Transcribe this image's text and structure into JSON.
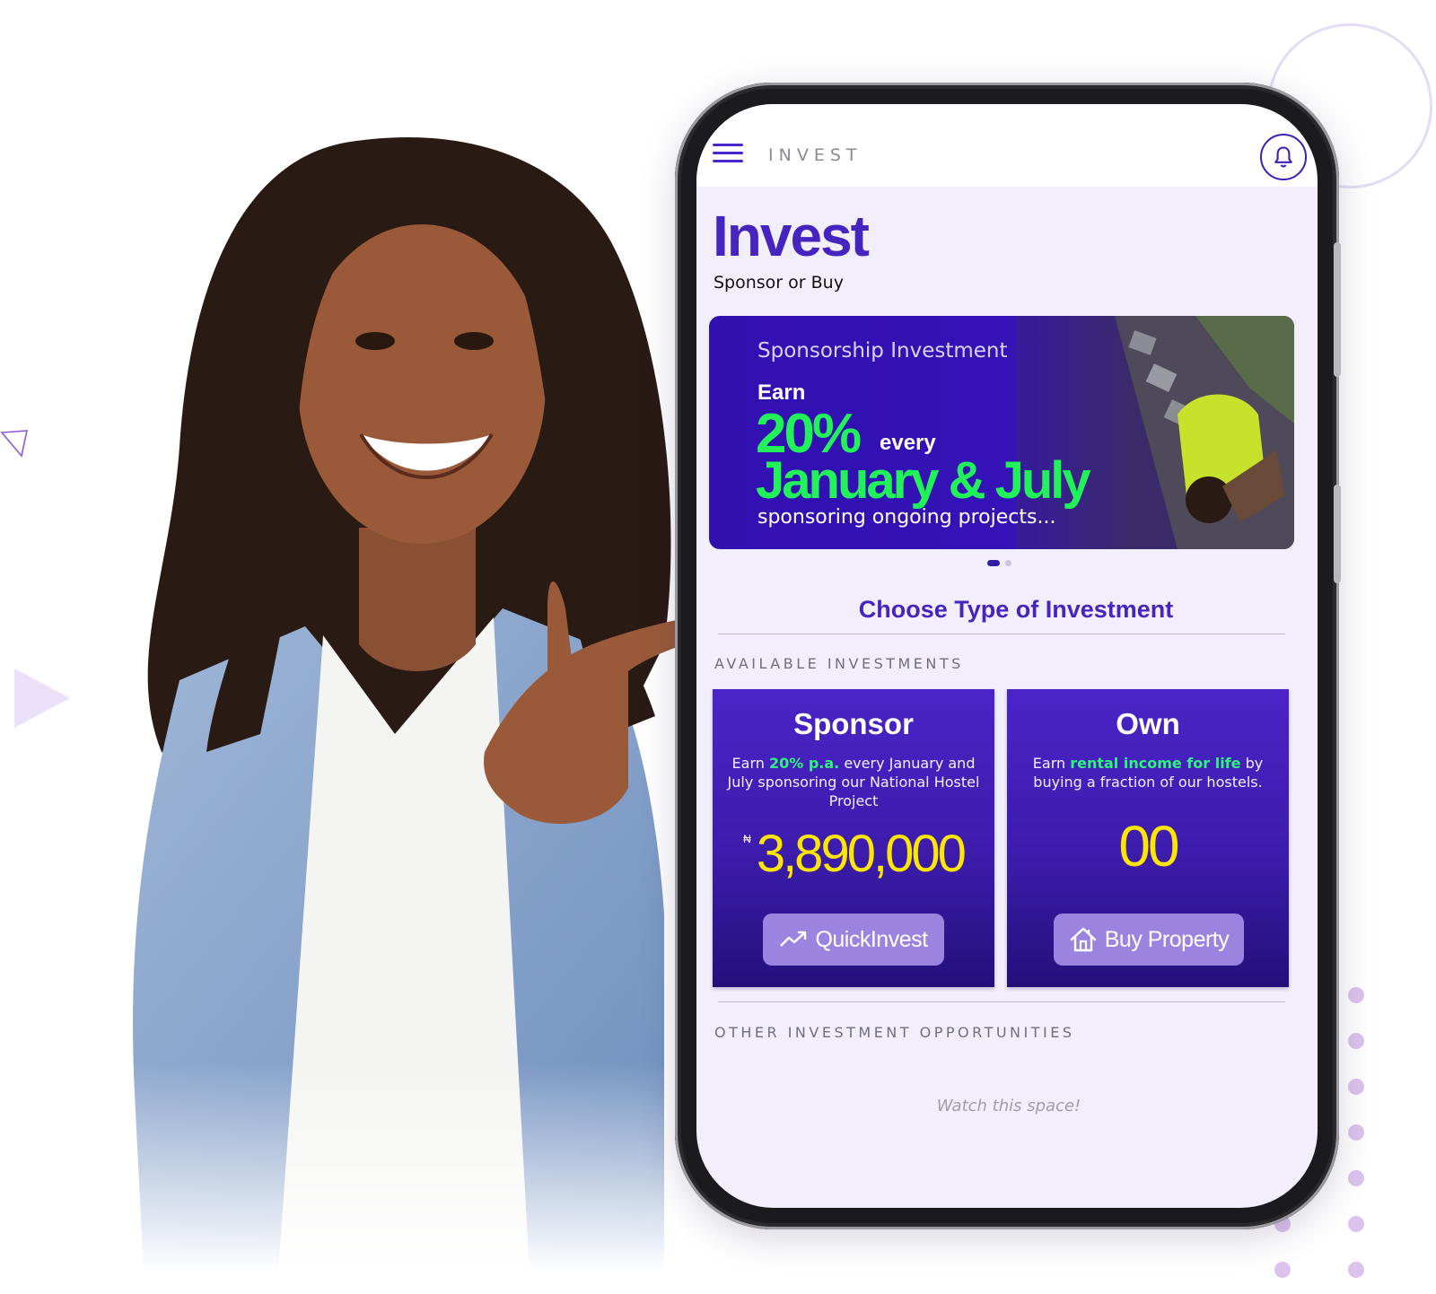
{
  "topbar": {
    "menu_icon": "hamburger-menu-icon",
    "title": "INVEST",
    "notification_icon": "bell-icon"
  },
  "page": {
    "title": "Invest",
    "subtitle": "Sponsor or Buy"
  },
  "banner": {
    "kicker": "Sponsorship Investment",
    "earn": "Earn",
    "rate": "20%",
    "every": "every",
    "months": "January & July",
    "tagline": "sponsoring ongoing projects...",
    "slides_total": 2,
    "active_slide": 1
  },
  "section": {
    "heading": "Choose Type of Investment",
    "available_label": "AVAILABLE INVESTMENTS",
    "other_label": "OTHER INVESTMENT OPPORTUNITIES",
    "empty_message": "Watch this space!"
  },
  "cards": [
    {
      "title": "Sponsor",
      "desc_pre": "Earn ",
      "desc_highlight": "20% p.a.",
      "desc_post": " every January and July sponsoring our National Hostel Project",
      "currency": "₦",
      "amount": "3,890,000",
      "button_label": "QuickInvest",
      "button_icon": "trending-up-icon"
    },
    {
      "title": "Own",
      "desc_pre": "Earn ",
      "desc_highlight": "rental income for life",
      "desc_post": " by buying a fraction of our hostels.",
      "amount": "00",
      "button_label": "Buy Property",
      "button_icon": "house-icon"
    }
  ],
  "colors": {
    "brand_purple": "#4524c0",
    "accent_green": "#22f25a",
    "amount_yellow": "#ffe600",
    "button_lilac": "#9b84e0",
    "screen_bg": "#f3eefb"
  }
}
